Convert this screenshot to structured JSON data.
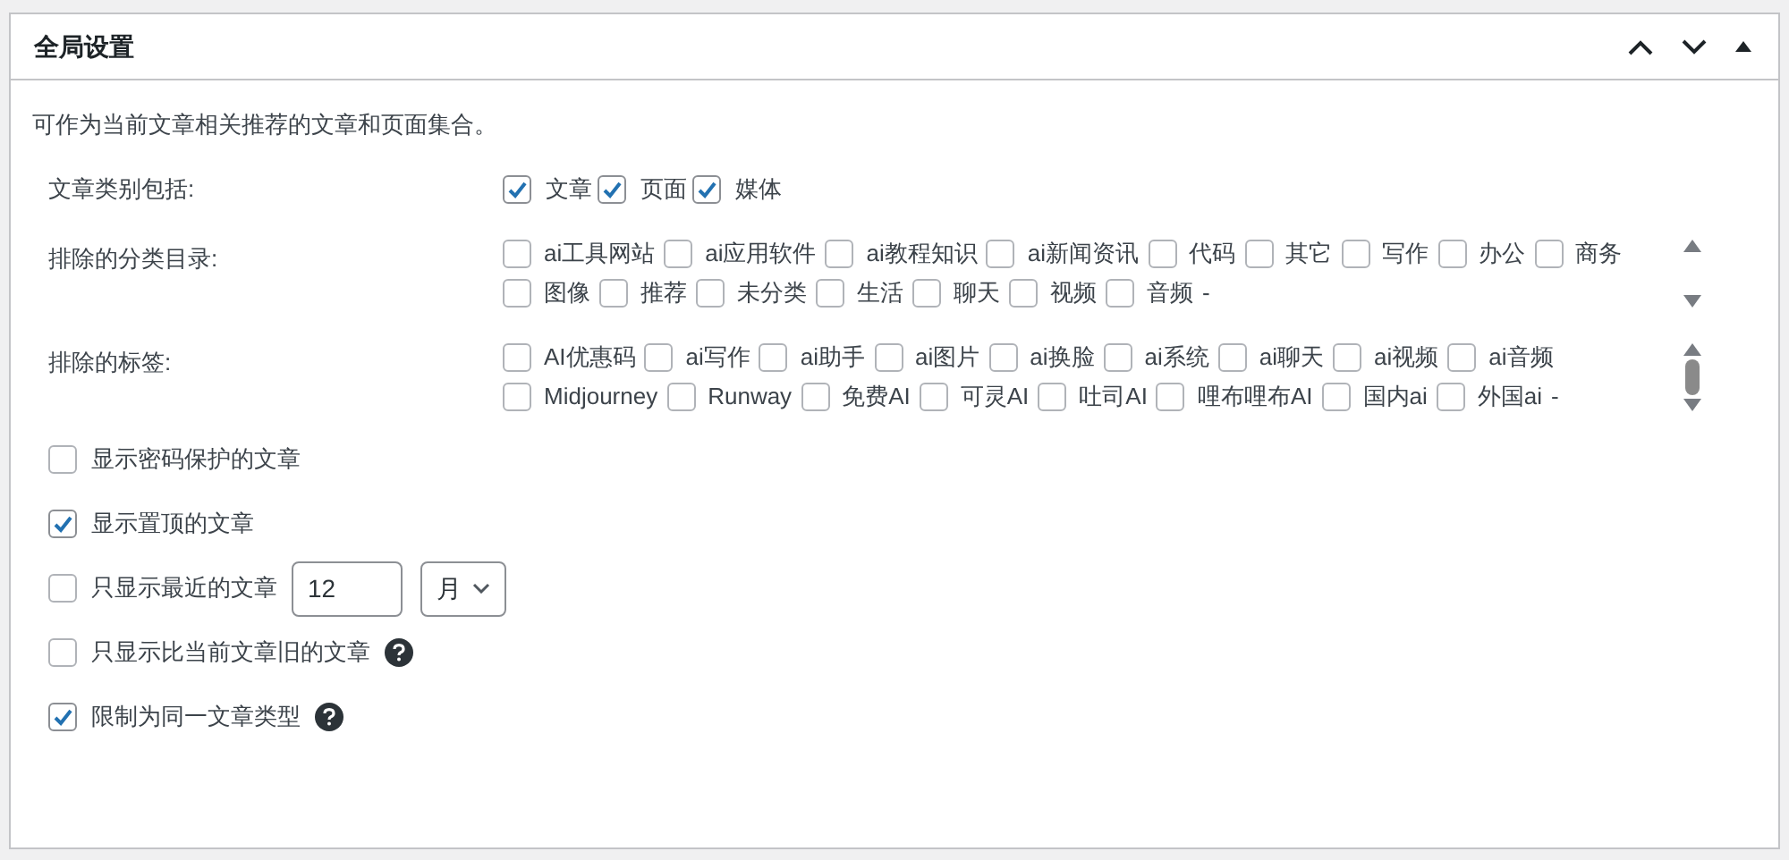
{
  "panel": {
    "title": "全局设置"
  },
  "description": "可作为当前文章相关推荐的文章和页面集合。",
  "post_types": {
    "label": "文章类别包括:",
    "items": [
      {
        "label": "文章",
        "checked": true
      },
      {
        "label": "页面",
        "checked": true
      },
      {
        "label": "媒体",
        "checked": true
      }
    ]
  },
  "excluded_categories": {
    "label": "排除的分类目录:",
    "more_mark": "-",
    "items": [
      {
        "label": "ai工具网站",
        "checked": false
      },
      {
        "label": "ai应用软件",
        "checked": false
      },
      {
        "label": "ai教程知识",
        "checked": false
      },
      {
        "label": "ai新闻资讯",
        "checked": false
      },
      {
        "label": "代码",
        "checked": false
      },
      {
        "label": "其它",
        "checked": false
      },
      {
        "label": "写作",
        "checked": false
      },
      {
        "label": "办公",
        "checked": false
      },
      {
        "label": "商务",
        "checked": false
      },
      {
        "label": "图像",
        "checked": false
      },
      {
        "label": "推荐",
        "checked": false
      },
      {
        "label": "未分类",
        "checked": false
      },
      {
        "label": "生活",
        "checked": false
      },
      {
        "label": "聊天",
        "checked": false
      },
      {
        "label": "视频",
        "checked": false
      },
      {
        "label": "音频",
        "checked": false
      }
    ]
  },
  "excluded_tags": {
    "label": "排除的标签:",
    "more_mark": "-",
    "items": [
      {
        "label": "AI优惠码",
        "checked": false
      },
      {
        "label": "ai写作",
        "checked": false
      },
      {
        "label": "ai助手",
        "checked": false
      },
      {
        "label": "ai图片",
        "checked": false
      },
      {
        "label": "ai换脸",
        "checked": false
      },
      {
        "label": "ai系统",
        "checked": false
      },
      {
        "label": "ai聊天",
        "checked": false
      },
      {
        "label": "ai视频",
        "checked": false
      },
      {
        "label": "ai音频",
        "checked": false
      },
      {
        "label": "Midjourney",
        "checked": false
      },
      {
        "label": "Runway",
        "checked": false
      },
      {
        "label": "免费AI",
        "checked": false
      },
      {
        "label": "可灵AI",
        "checked": false
      },
      {
        "label": "吐司AI",
        "checked": false
      },
      {
        "label": "哩布哩布AI",
        "checked": false
      },
      {
        "label": "国内ai",
        "checked": false
      },
      {
        "label": "外国ai",
        "checked": false
      }
    ]
  },
  "options": [
    {
      "kind": "checkbox",
      "label": "显示密码保护的文章",
      "checked": false
    },
    {
      "kind": "checkbox",
      "label": "显示置顶的文章",
      "checked": true
    },
    {
      "kind": "recent",
      "label": "只显示最近的文章",
      "checked": false,
      "value": "12",
      "unit": "月"
    },
    {
      "kind": "help",
      "label": "只显示比当前文章旧的文章",
      "checked": false
    },
    {
      "kind": "help",
      "label": "限制为同一文章类型",
      "checked": true
    }
  ]
}
